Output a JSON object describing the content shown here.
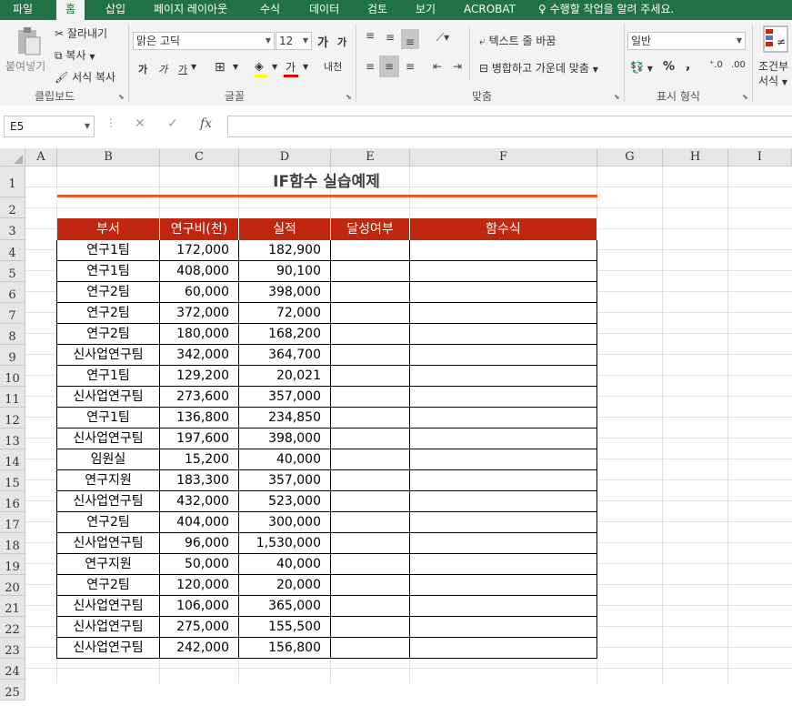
{
  "menu": {
    "tabs": [
      "파일",
      "홈",
      "삽입",
      "페이지 레이아웃",
      "수식",
      "데이터",
      "검토",
      "보기",
      "ACROBAT"
    ],
    "active_index": 1,
    "tell_me": "수행할 작업을 알려 주세요."
  },
  "ribbon": {
    "clipboard": {
      "paste": "붙여넣기",
      "cut": "잘라내기",
      "copy": "복사",
      "format_painter": "서식 복사",
      "group": "클립보드"
    },
    "font": {
      "name": "맑은 고딕",
      "size": "12",
      "grow": "가",
      "shrink": "가",
      "bold": "가",
      "italic": "가",
      "underline": "가",
      "font_color": "가",
      "phonetic": "내천",
      "group": "글꼴"
    },
    "alignment": {
      "wrap_text": "텍스트 줄 바꿈",
      "merge_center": "병합하고 가운데 맞춤",
      "group": "맞춤"
    },
    "number": {
      "format": "일반",
      "percent": "%",
      "comma": ",",
      "group": "표시 형식"
    },
    "styles": {
      "conditional_line1": "조건부",
      "conditional_line2": "서식"
    }
  },
  "formula_bar": {
    "name_box": "E5",
    "cancel": "✕",
    "enter": "✓",
    "fx": "fx",
    "formula": ""
  },
  "sheet": {
    "columns": [
      "A",
      "B",
      "C",
      "D",
      "E",
      "F",
      "G",
      "H",
      "I"
    ],
    "rows": [
      "1",
      "2",
      "3",
      "4",
      "5",
      "6",
      "7",
      "8",
      "9",
      "10",
      "11",
      "12",
      "13",
      "14",
      "15",
      "16",
      "17",
      "18",
      "19",
      "20",
      "21",
      "22",
      "23",
      "24",
      "25"
    ],
    "title": "IF함수 실습예제",
    "headers": [
      "부서",
      "연구비(천)",
      "실적",
      "달성여부",
      "함수식"
    ],
    "data": [
      [
        "연구1팀",
        "172,000",
        "182,900"
      ],
      [
        "연구1팀",
        "408,000",
        "90,100"
      ],
      [
        "연구2팀",
        "60,000",
        "398,000"
      ],
      [
        "연구2팀",
        "372,000",
        "72,000"
      ],
      [
        "연구2팀",
        "180,000",
        "168,200"
      ],
      [
        "신사업연구팀",
        "342,000",
        "364,700"
      ],
      [
        "연구1팀",
        "129,200",
        "20,021"
      ],
      [
        "신사업연구팀",
        "273,600",
        "357,000"
      ],
      [
        "연구1팀",
        "136,800",
        "234,850"
      ],
      [
        "신사업연구팀",
        "197,600",
        "398,000"
      ],
      [
        "임원실",
        "15,200",
        "40,000"
      ],
      [
        "연구지원",
        "183,300",
        "357,000"
      ],
      [
        "신사업연구팀",
        "432,000",
        "523,000"
      ],
      [
        "연구2팀",
        "404,000",
        "300,000"
      ],
      [
        "신사업연구팀",
        "96,000",
        "1,530,000"
      ],
      [
        "연구지원",
        "50,000",
        "40,000"
      ],
      [
        "연구2팀",
        "120,000",
        "20,000"
      ],
      [
        "신사업연구팀",
        "106,000",
        "365,000"
      ],
      [
        "신사업연구팀",
        "275,000",
        "155,500"
      ],
      [
        "신사업연구팀",
        "242,000",
        "156,800"
      ]
    ]
  },
  "colors": {
    "excel_green": "#217346",
    "header_red": "#c0270e",
    "title_underline": "#ea5a25"
  }
}
